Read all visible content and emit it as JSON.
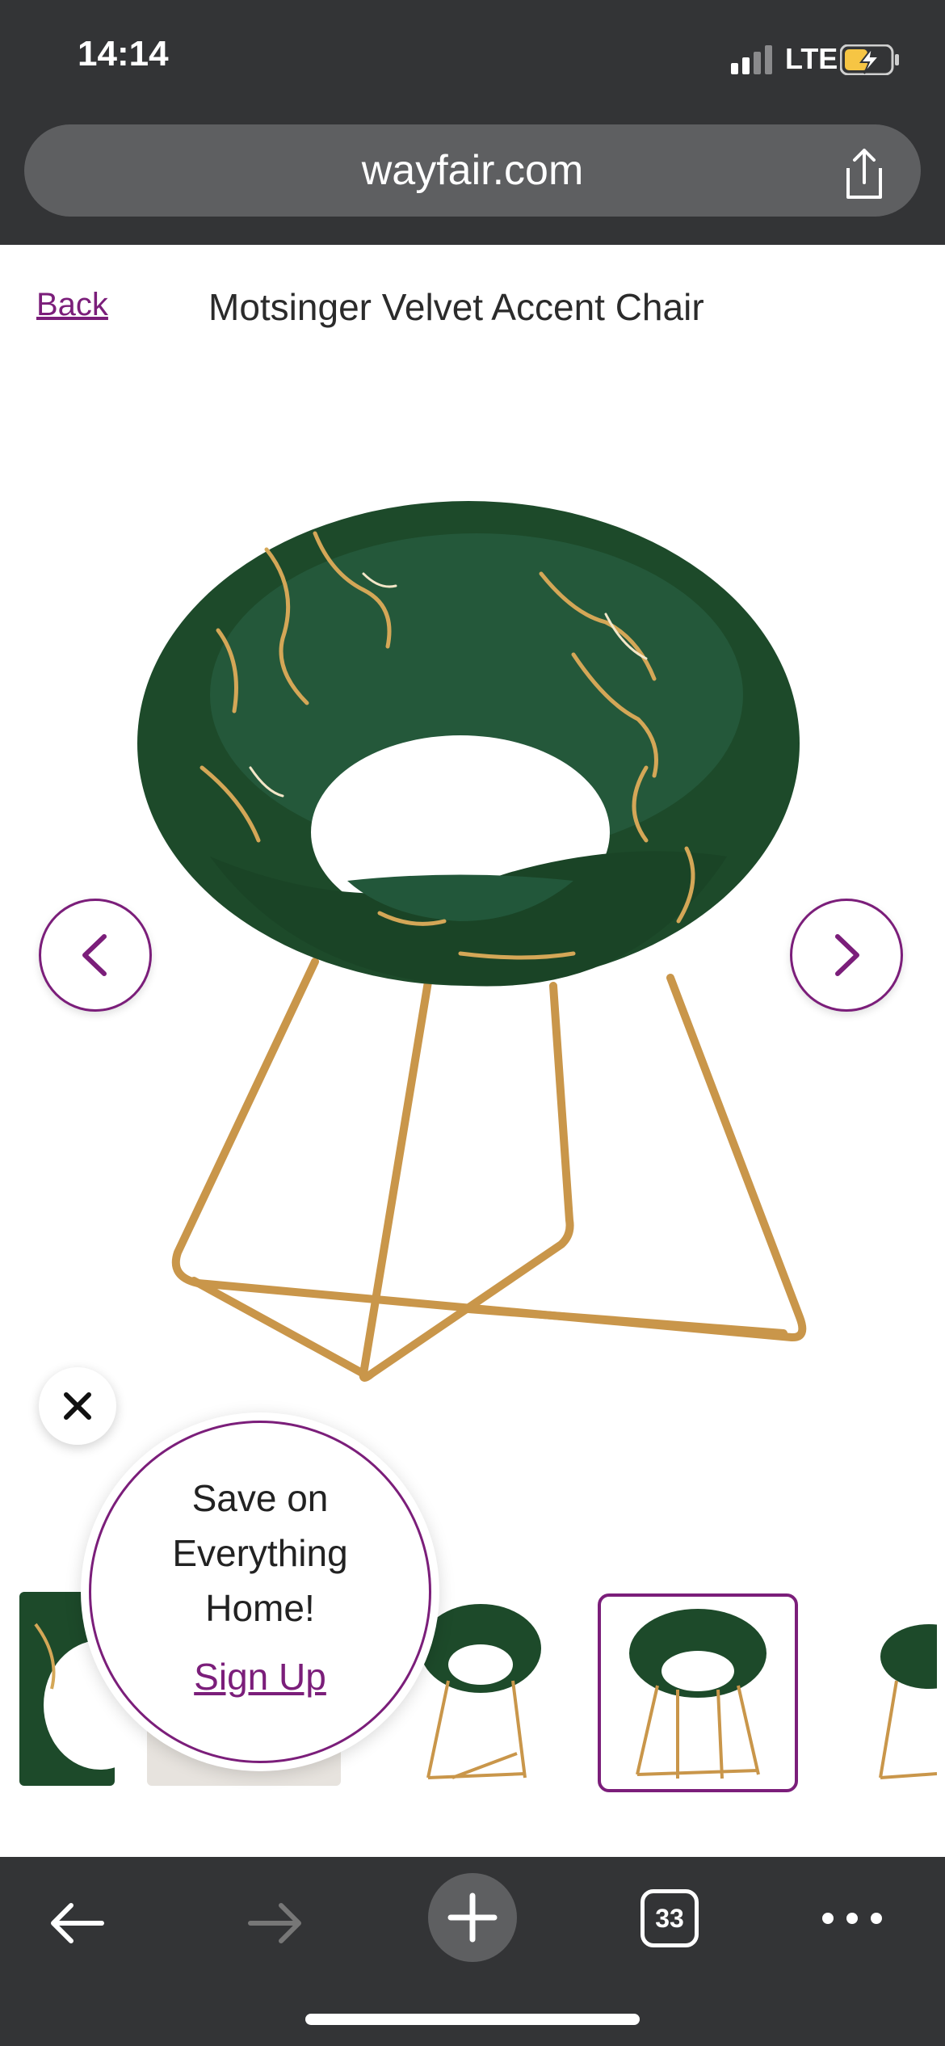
{
  "status": {
    "time": "14:14",
    "network": "LTE"
  },
  "browser": {
    "url": "wayfair.com",
    "tabs_count": "33"
  },
  "header": {
    "back_label": "Back",
    "title": "Motsinger Velvet Accent Chair"
  },
  "gallery": {
    "selected_index": 3,
    "thumb_count": 5
  },
  "promo": {
    "line1": "Save on",
    "line2": "Everything",
    "line3": "Home!",
    "link": "Sign Up"
  },
  "colors": {
    "brand": "#7b1e7a",
    "chrome": "#333436",
    "urlbar": "#5e5f61",
    "velvet": "#1f4a2c",
    "gold": "#c9964a"
  },
  "icons": [
    "share-icon",
    "chevron-left-icon",
    "chevron-right-icon",
    "close-icon",
    "back-arrow-icon",
    "forward-arrow-icon",
    "plus-icon",
    "tabs-icon",
    "more-icon"
  ]
}
